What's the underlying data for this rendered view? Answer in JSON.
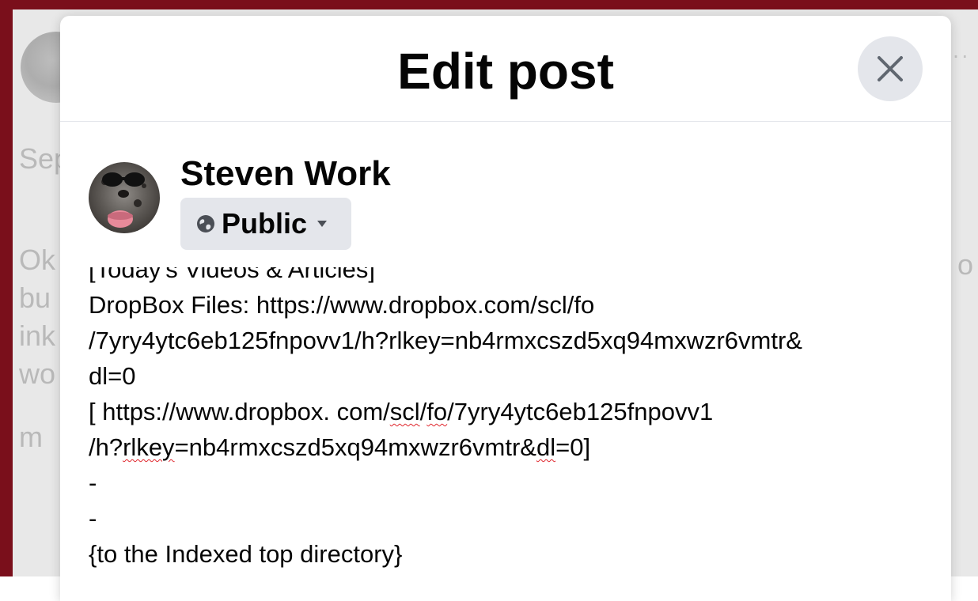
{
  "background": {
    "text_fragments": [
      "Sep",
      "Ok",
      "bu",
      "ink",
      "wo",
      "m"
    ],
    "right_fragment": "o",
    "more_dots": "···"
  },
  "modal": {
    "title": "Edit post",
    "close_icon": "close-icon"
  },
  "author": {
    "name": "Steven Work",
    "privacy": {
      "label": "Public",
      "icon": "globe-icon",
      "caret_icon": "caret-down-icon"
    }
  },
  "editor": {
    "clipped_first_line": "[Today's Videos & Articles]",
    "lines": [
      {
        "parts": [
          {
            "text": "DropBox Files: https://www.dropbox.com/scl/fo"
          }
        ]
      },
      {
        "parts": [
          {
            "text": "/7yry4ytc6eb125fnpovv1/h?rlkey=nb4rmxcszd5xq94mxwzr6vmtr&"
          }
        ]
      },
      {
        "parts": [
          {
            "text": "dl=0"
          }
        ]
      },
      {
        "parts": [
          {
            "text": "[ https://www.dropbox. com/"
          },
          {
            "text": "scl",
            "spell": true
          },
          {
            "text": "/"
          },
          {
            "text": "fo",
            "spell": true
          },
          {
            "text": "/7yry4ytc6eb125fnpovv1"
          }
        ]
      },
      {
        "parts": [
          {
            "text": "/h?"
          },
          {
            "text": "rlkey",
            "spell": true
          },
          {
            "text": "=nb4rmxcszd5xq94mxwzr6vmtr&"
          },
          {
            "text": "dl",
            "spell": true
          },
          {
            "text": "=0]"
          }
        ]
      },
      {
        "parts": [
          {
            "text": "-"
          }
        ]
      },
      {
        "parts": [
          {
            "text": "-"
          }
        ]
      },
      {
        "parts": [
          {
            "text": "{to the Indexed top directory}"
          }
        ]
      }
    ]
  },
  "colors": {
    "frame": "#7a0f1b",
    "button_bg": "#e4e6eb",
    "text": "#050505",
    "spellcheck": "#e0272d"
  }
}
